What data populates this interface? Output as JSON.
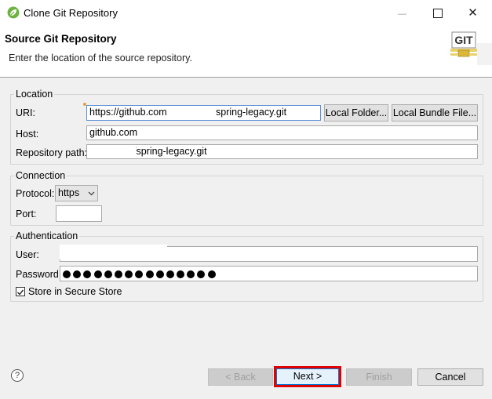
{
  "window": {
    "title": "Clone Git Repository",
    "minimize_glyph": "—",
    "maximize_glyph": "☐",
    "close_glyph": "✕"
  },
  "header": {
    "title": "Source Git Repository",
    "description": "Enter the location of the source repository.",
    "badge_text": "GIT"
  },
  "location": {
    "legend": "Location",
    "uri_label": "URI:",
    "uri_value_start": "https://github.com",
    "uri_value_end": "spring-legacy.git",
    "local_folder_button": "Local Folder...",
    "local_bundle_button": "Local Bundle File...",
    "host_label": "Host:",
    "host_value": "github.com",
    "repo_path_label": "Repository path:",
    "repo_path_value": "/spring-legacy.git"
  },
  "connection": {
    "legend": "Connection",
    "protocol_label": "Protocol:",
    "protocol_value": "https",
    "port_label": "Port:",
    "port_value": ""
  },
  "authentication": {
    "legend": "Authentication",
    "user_label": "User:",
    "user_value": "",
    "password_label": "Password:",
    "password_length": 15,
    "store_label": "Store in Secure Store",
    "store_checked": true
  },
  "footer": {
    "help_glyph": "?",
    "back_button": "< Back",
    "next_button": "Next >",
    "finish_button": "Finish",
    "cancel_button": "Cancel"
  },
  "colors": {
    "highlight": "#e00000",
    "focus": "#5a8fd8"
  }
}
